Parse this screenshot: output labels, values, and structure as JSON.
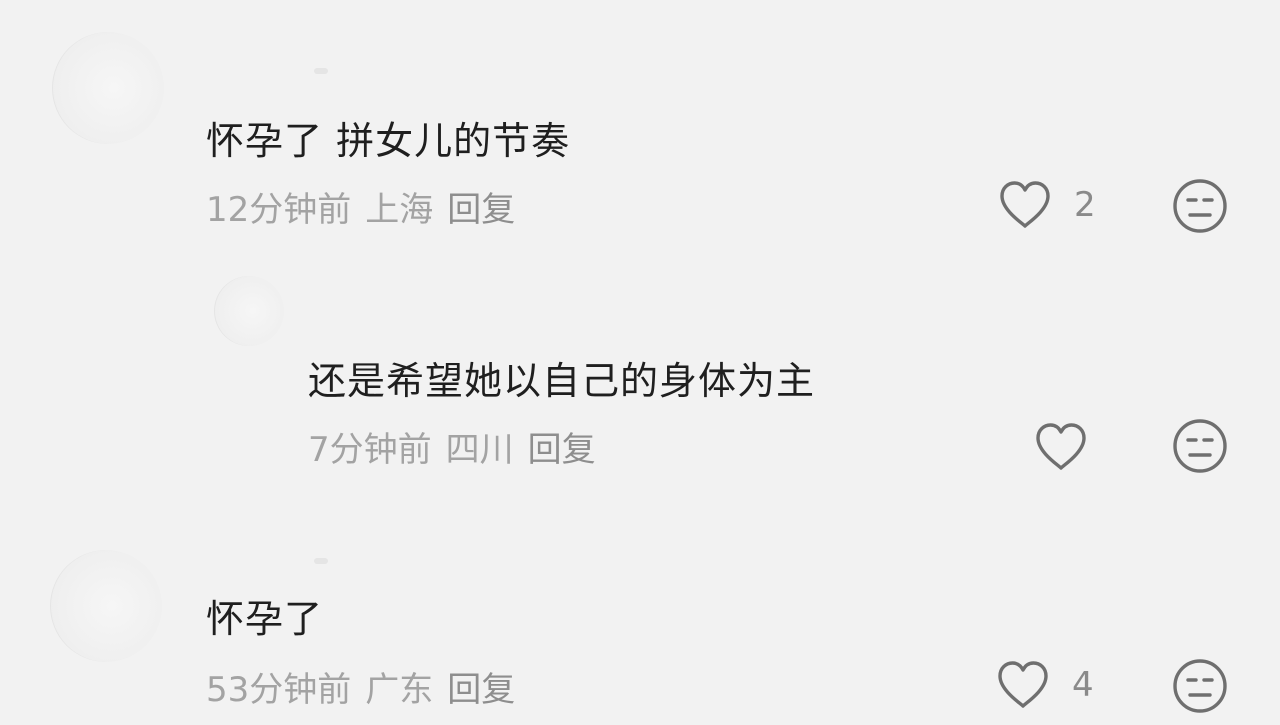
{
  "comments": [
    {
      "content": "怀孕了 拼女儿的节奏",
      "time": "12分钟前",
      "location": "上海",
      "reply_label": "回复",
      "like_count": "2"
    },
    {
      "content": "还是希望她以自己的身体为主",
      "time": "7分钟前",
      "location": "四川",
      "reply_label": "回复",
      "like_count": ""
    },
    {
      "content": "怀孕了",
      "time": "53分钟前",
      "location": "广东",
      "reply_label": "回复",
      "like_count": "4"
    }
  ],
  "icons": {
    "like": "heart-outline-icon",
    "dislike": "neutral-face-icon"
  },
  "colors": {
    "background": "#f2f2f2",
    "content_text": "#1f1f1f",
    "meta_text": "#a3a3a3",
    "icon_stroke": "#6f6f6f"
  }
}
